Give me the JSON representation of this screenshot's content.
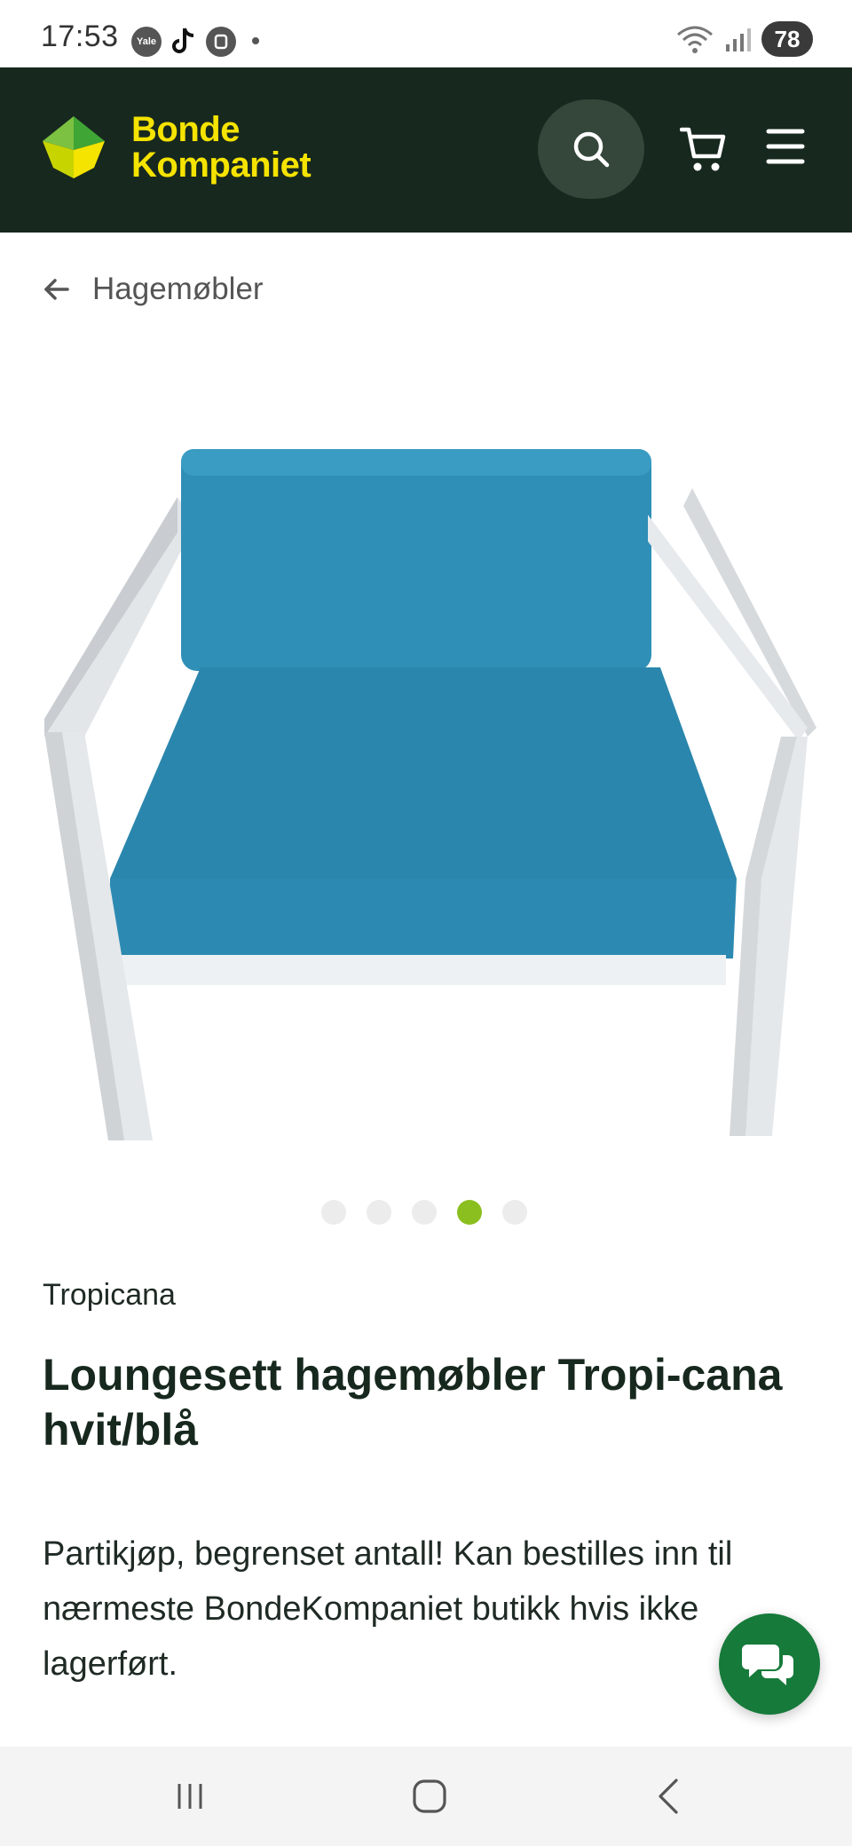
{
  "status_bar": {
    "time": "17:53",
    "apps": [
      "Yale",
      "tiktok-icon",
      "app-icon"
    ],
    "network": "6E",
    "battery": "78"
  },
  "header": {
    "logo_line1": "Bonde",
    "logo_line2": "Kompaniet",
    "brand_colors": {
      "background": "#17281e",
      "logo_text": "#f5e300",
      "search_bg": "#34473a"
    },
    "icons": [
      "search-icon",
      "cart-icon",
      "menu-icon"
    ]
  },
  "breadcrumb": {
    "label": "Hagemøbler",
    "icon": "arrow-left-icon"
  },
  "gallery": {
    "slide_count": 5,
    "active_index": 3,
    "active_color": "#8bbf1f"
  },
  "product": {
    "brand": "Tropicana",
    "title": "Loungesett hagemøbler Tropi-cana hvit/blå",
    "description": "Partikjøp, begrenset antall! Kan bestilles inn til nærmeste BondeKompaniet butikk hvis ikke lagerført."
  },
  "chat": {
    "icon": "chat-icon",
    "color": "#167a3a"
  },
  "nav_bar": {
    "icons": [
      "recents-icon",
      "home-icon",
      "back-icon"
    ]
  }
}
